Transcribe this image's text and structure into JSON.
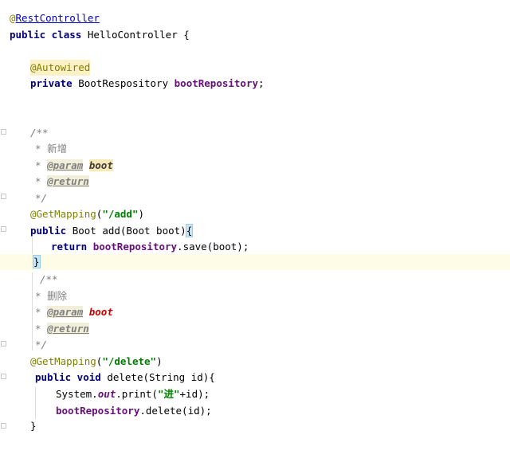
{
  "editor": {
    "class_annotation_at": "@",
    "class_annotation_name": "RestController",
    "class_decl_kw": "public class",
    "class_name": "HelloController",
    "open_brace": "{",
    "autowired": "@Autowired",
    "field_kw": "private",
    "field_type": "BootRespository",
    "field_name": "bootRepository",
    "semicolon": ";",
    "doc1": {
      "open": "/**",
      "star": "*",
      "desc": "新增",
      "param_tag": "@param",
      "param_name": "boot",
      "return_tag": "@return",
      "close": "*/"
    },
    "get_mapping_add": {
      "annotation": "@GetMapping",
      "open_paren": "(",
      "path": "\"/add\"",
      "close_paren": ")"
    },
    "method_add": {
      "modifier": "public",
      "signature": "Boot add(Boot boot)",
      "brace": "{",
      "return_kw": "return",
      "call_target": "bootRepository",
      "call_rest": ".save(boot);",
      "close": "}"
    },
    "doc2": {
      "open": "/**",
      "star": "*",
      "desc": "删除",
      "param_tag": "@param",
      "param_name": "boot",
      "return_tag": "@return",
      "close": "*/"
    },
    "get_mapping_delete": {
      "annotation": "@GetMapping",
      "open_paren": "(",
      "path": "\"/delete\"",
      "close_paren": ")"
    },
    "method_delete": {
      "modifier": "public void",
      "signature": "delete(String id){",
      "print_system": "System.",
      "print_out": "out",
      "print_call": ".print(",
      "print_str_open": "\"",
      "print_str_text": "进",
      "print_str_close": "\"",
      "print_rest": "+id);",
      "call_target": "bootRepository",
      "call_rest": ".delete(id);",
      "close": "}"
    }
  }
}
